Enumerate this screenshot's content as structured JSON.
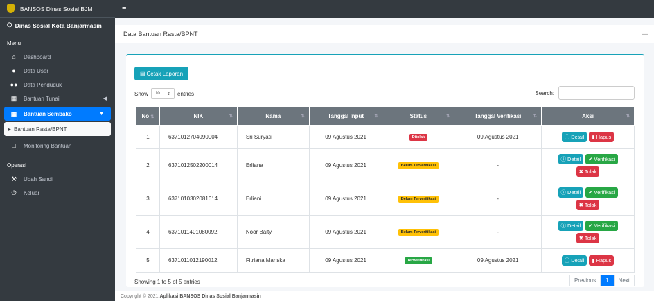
{
  "brand": {
    "title": "BANSOS Dinas Sosial BJM"
  },
  "sidebar": {
    "org": "Dinas Sosial Kota Banjarmasin",
    "menu_heading": "Menu",
    "items": [
      {
        "label": "Dashboard",
        "icon": "home-icon"
      },
      {
        "label": "Data User",
        "icon": "user-icon"
      },
      {
        "label": "Data Penduduk",
        "icon": "users-icon"
      },
      {
        "label": "Bantuan Tunai",
        "icon": "table-icon"
      },
      {
        "label": "Bantuan Sembako",
        "icon": "table-icon"
      },
      {
        "label": "Bantuan Rasta/BPNT",
        "icon": "caret-right-icon"
      },
      {
        "label": "Monitoring Bantuan",
        "icon": "file-icon"
      }
    ],
    "operasi_heading": "Operasi",
    "ops": [
      {
        "label": "Ubah Sandi",
        "icon": "wrench-icon"
      },
      {
        "label": "Keluar",
        "icon": "power-icon"
      }
    ]
  },
  "topbar": {
    "menu_icon": "≡"
  },
  "page": {
    "title": "Data Bantuan Rasta/BPNT",
    "minimize": "—"
  },
  "card": {
    "cetak_label": "Cetak Laporan",
    "show_label": "Show",
    "show_value": "10",
    "entries_label": "entries",
    "search_label": "Search:",
    "columns": [
      "No",
      "NIK",
      "Nama",
      "Tanggal Input",
      "Status",
      "Tanggal Verifikasi",
      "Aksi"
    ],
    "rows": [
      {
        "no": "1",
        "nik": "6371012704090004",
        "nama": "Sri Suryati",
        "tgl_input": "09 Agustus 2021",
        "status": "Ditolak",
        "tgl_verif": "09 Agustus 2021"
      },
      {
        "no": "2",
        "nik": "6371012502200014",
        "nama": "Erliana",
        "tgl_input": "09 Agustus 2021",
        "status": "Belum Terverifikasi",
        "tgl_verif": "-"
      },
      {
        "no": "3",
        "nik": "6371010302081614",
        "nama": "Erliani",
        "tgl_input": "09 Agustus 2021",
        "status": "Belum Terverifikasi",
        "tgl_verif": "-"
      },
      {
        "no": "4",
        "nik": "6371011401080092",
        "nama": "Noor Baity",
        "tgl_input": "09 Agustus 2021",
        "status": "Belum Terverifikasi",
        "tgl_verif": "-"
      },
      {
        "no": "5",
        "nik": "6371011012190012",
        "nama": "Fitriana Mariska",
        "tgl_input": "09 Agustus 2021",
        "status": "Terverifikasi",
        "tgl_verif": "09 Agustus 2021"
      }
    ],
    "actions": {
      "detail": "Detail",
      "hapus": "Hapus",
      "verifikasi": "Verifikasi",
      "tolak": "Tolak"
    },
    "info": "Showing 1 to 5 of 5 entries",
    "pager": {
      "prev": "Previous",
      "page": "1",
      "next": "Next"
    }
  },
  "footer": {
    "prefix": "Copyright © 2021 ",
    "app": "Aplikasi BANSOS Dinas Sosial Banjarmasin"
  },
  "colors": {
    "sidebar": "#343a40",
    "primary": "#007bff",
    "info": "#17a2b8",
    "danger": "#dc3545",
    "warning": "#ffc107",
    "success": "#28a745"
  }
}
